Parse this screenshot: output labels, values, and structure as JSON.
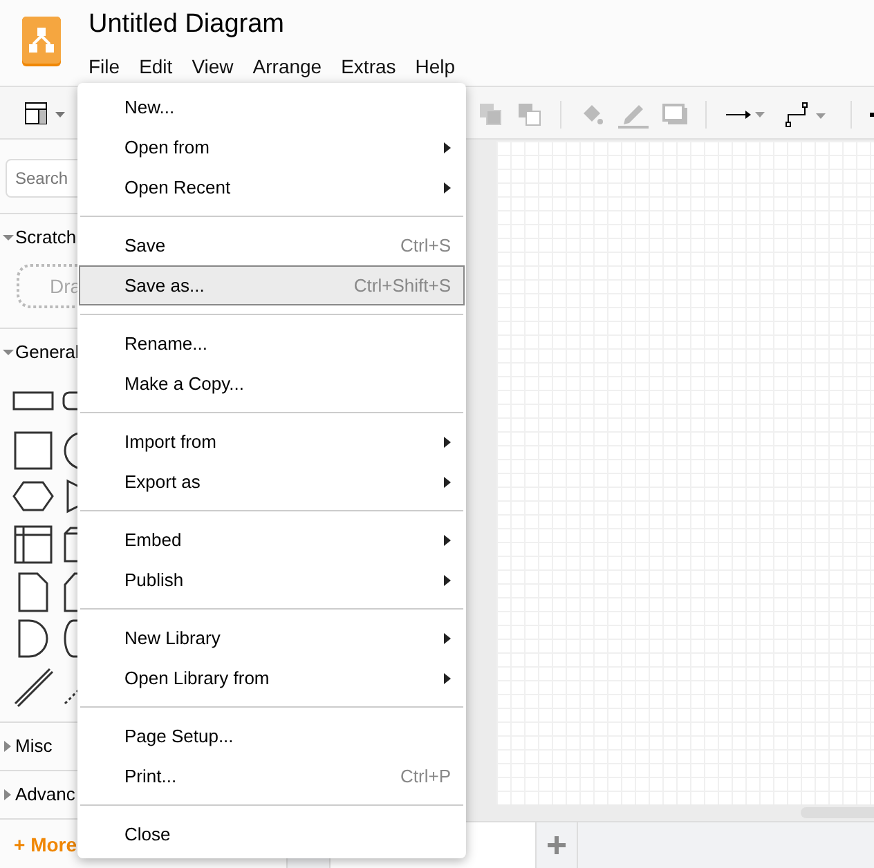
{
  "window": {
    "title": "Untitled Diagram"
  },
  "menubar": [
    {
      "label": "File"
    },
    {
      "label": "Edit"
    },
    {
      "label": "View"
    },
    {
      "label": "Arrange"
    },
    {
      "label": "Extras"
    },
    {
      "label": "Help"
    }
  ],
  "sidebar": {
    "search": {
      "placeholder": "Search"
    },
    "sections": [
      {
        "label": "Scratch",
        "expanded": true,
        "kind": "scratch",
        "drop_hint": "Dra"
      },
      {
        "label": "General",
        "expanded": true,
        "kind": "shapes"
      },
      {
        "label": "Misc",
        "expanded": false
      },
      {
        "label": "Advanc",
        "expanded": false
      }
    ],
    "more_link": "+ More"
  },
  "file_menu": [
    {
      "kind": "item",
      "label": "New...",
      "submenu": false,
      "selected": false
    },
    {
      "kind": "item",
      "label": "Open from",
      "submenu": true,
      "selected": false
    },
    {
      "kind": "item",
      "label": "Open Recent",
      "submenu": true,
      "selected": false
    },
    {
      "kind": "separator"
    },
    {
      "kind": "item",
      "label": "Save",
      "shortcut": "Ctrl+S",
      "submenu": false,
      "selected": false
    },
    {
      "kind": "item",
      "label": "Save as...",
      "shortcut": "Ctrl+Shift+S",
      "submenu": false,
      "selected": true
    },
    {
      "kind": "separator"
    },
    {
      "kind": "item",
      "label": "Rename...",
      "submenu": false,
      "selected": false
    },
    {
      "kind": "item",
      "label": "Make a Copy...",
      "submenu": false,
      "selected": false
    },
    {
      "kind": "separator"
    },
    {
      "kind": "item",
      "label": "Import from",
      "submenu": true,
      "selected": false
    },
    {
      "kind": "item",
      "label": "Export as",
      "submenu": true,
      "selected": false
    },
    {
      "kind": "separator"
    },
    {
      "kind": "item",
      "label": "Embed",
      "submenu": true,
      "selected": false
    },
    {
      "kind": "item",
      "label": "Publish",
      "submenu": true,
      "selected": false
    },
    {
      "kind": "separator"
    },
    {
      "kind": "item",
      "label": "New Library",
      "submenu": true,
      "selected": false
    },
    {
      "kind": "item",
      "label": "Open Library from",
      "submenu": true,
      "selected": false
    },
    {
      "kind": "separator"
    },
    {
      "kind": "item",
      "label": "Page Setup...",
      "submenu": false,
      "selected": false
    },
    {
      "kind": "item",
      "label": "Print...",
      "shortcut": "Ctrl+P",
      "submenu": false,
      "selected": false
    },
    {
      "kind": "separator"
    },
    {
      "kind": "item",
      "label": "Close",
      "submenu": false,
      "selected": false
    }
  ]
}
